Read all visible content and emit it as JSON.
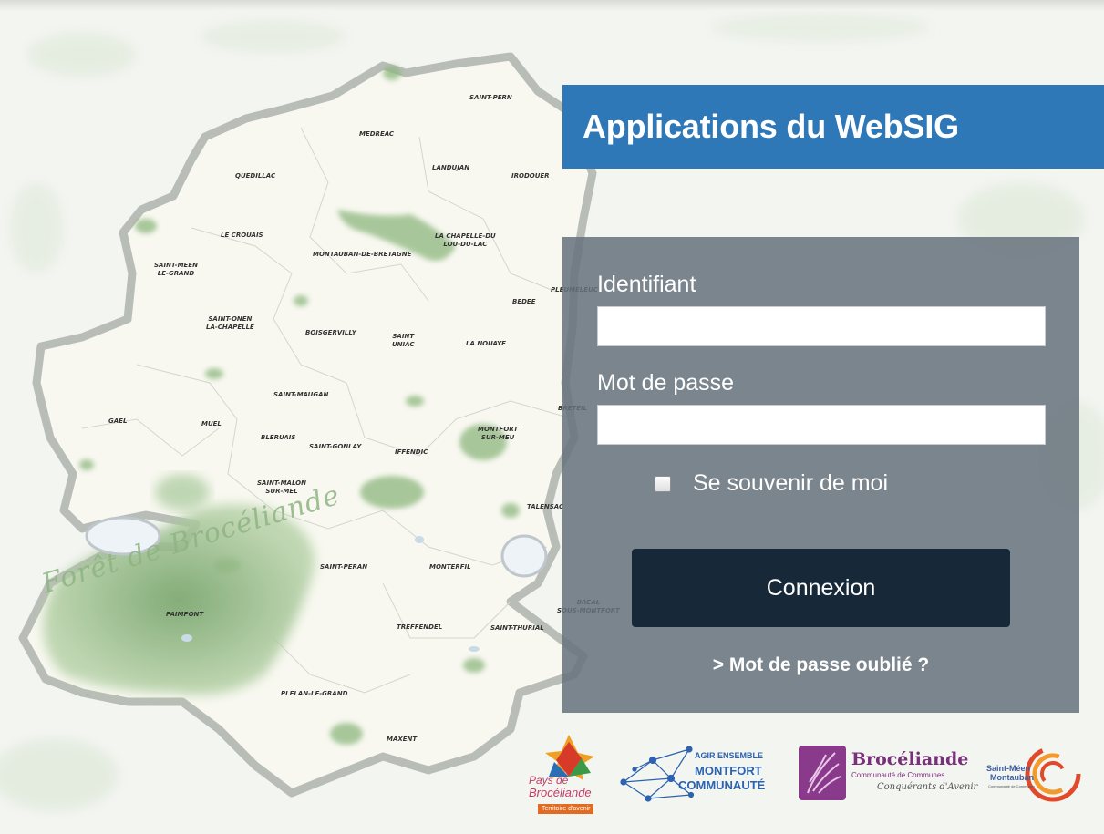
{
  "app": {
    "title": "Applications du WebSIG"
  },
  "map": {
    "forest_label": "Forêt de Brocéliande",
    "towns": [
      "SAINT-PERN",
      "MEDREAC",
      "QUEDILLAC",
      "LANDUJAN",
      "IRODOUER",
      "LA CHAPELLE-DU\nLOU-DU-LAC",
      "LE CROUAIS",
      "MONTAUBAN-DE-BRETAGNE",
      "SAINT-MEEN\nLE-GRAND",
      "SAINT-ONEN\nLA-CHAPELLE",
      "BOISGERVILLY",
      "SAINT\nUNIAC",
      "LA NOUAYE",
      "BEDEE",
      "PLEUMELEUC",
      "SAINT-MAUGAN",
      "GAEL",
      "MUEL",
      "BLERUAIS",
      "SAINT-GONLAY",
      "IFFENDIC",
      "MONTFORT\nSUR-MEU",
      "BRETEIL",
      "SAINT-MALON\nSUR-MEL",
      "TALENSAC",
      "SAINT-PERAN",
      "MONTERFIL",
      "PAIMPONT",
      "TREFFENDEL",
      "SAINT-THURIAL",
      "BREAL\nSOUS-MONTFORT",
      "PLELAN-LE-GRAND",
      "MAXENT"
    ]
  },
  "login": {
    "username_label": "Identifiant",
    "username_value": "",
    "password_label": "Mot de passe",
    "password_value": "",
    "remember_label": "Se souvenir de moi",
    "remember_checked": false,
    "submit_label": "Connexion",
    "forgot_link": "> Mot de passe oublié ?"
  },
  "partners": {
    "pays": {
      "line1": "Pays de",
      "line2": "Brocéliande",
      "tag": "Territoire d'avenir"
    },
    "montfort": {
      "line1": "AGIR ENSEMBLE",
      "line2": "MONTFORT",
      "line3": "COMMUNAUTÉ"
    },
    "broceliande": {
      "name": "Brocéliande",
      "sub": "Communauté de Communes",
      "motto": "Conquérants d'Avenir"
    },
    "stmeen": {
      "line1": "Saint-Méen",
      "line2": "Montauban",
      "line3": "Communauté de Communes"
    }
  },
  "colors": {
    "title_bar": "#2e78b8",
    "panel": "#67727d",
    "button": "#172838"
  }
}
